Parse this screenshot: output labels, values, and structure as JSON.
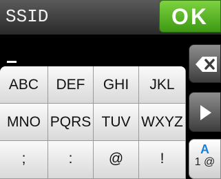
{
  "header": {
    "title": "SSID",
    "ok_label": "OK"
  },
  "entry": {
    "value": ""
  },
  "keypad": {
    "rows": [
      [
        "ABC",
        "DEF",
        "GHI",
        "JKL"
      ],
      [
        "MNO",
        "PQRS",
        "TUV",
        "WXYZ"
      ],
      [
        ";",
        ":",
        "@",
        "!"
      ]
    ]
  },
  "side": {
    "backspace_icon": "backspace-icon",
    "next_icon": "arrow-right-icon",
    "mode_top": "A",
    "mode_bottom": "1 @"
  },
  "colors": {
    "ok_green": "#5cb82a",
    "mode_blue": "#1e7fd9"
  }
}
